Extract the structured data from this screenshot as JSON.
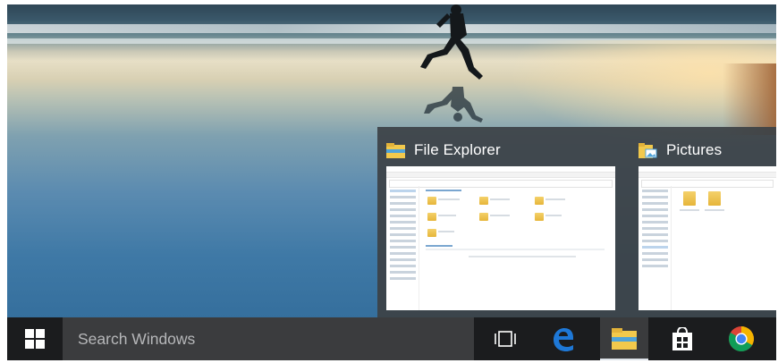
{
  "task_view": {
    "windows": [
      {
        "title": "File Explorer",
        "icon": "file-explorer-icon"
      },
      {
        "title": "Pictures",
        "icon": "pictures-folder-icon"
      }
    ]
  },
  "taskbar": {
    "start_icon": "windows-logo-icon",
    "search_placeholder": "Search Windows",
    "pinned": [
      {
        "icon": "task-view-icon"
      },
      {
        "icon": "edge-icon"
      },
      {
        "icon": "file-explorer-icon",
        "active": true
      },
      {
        "icon": "store-icon"
      },
      {
        "icon": "chrome-icon"
      }
    ]
  },
  "colors": {
    "taskbar": "#1b1c1e",
    "search_box": "#3b3c3e",
    "thumb_panel": "#3c4246",
    "edge_blue": "#1e78d7",
    "folder_yellow": "#f2c94c"
  }
}
